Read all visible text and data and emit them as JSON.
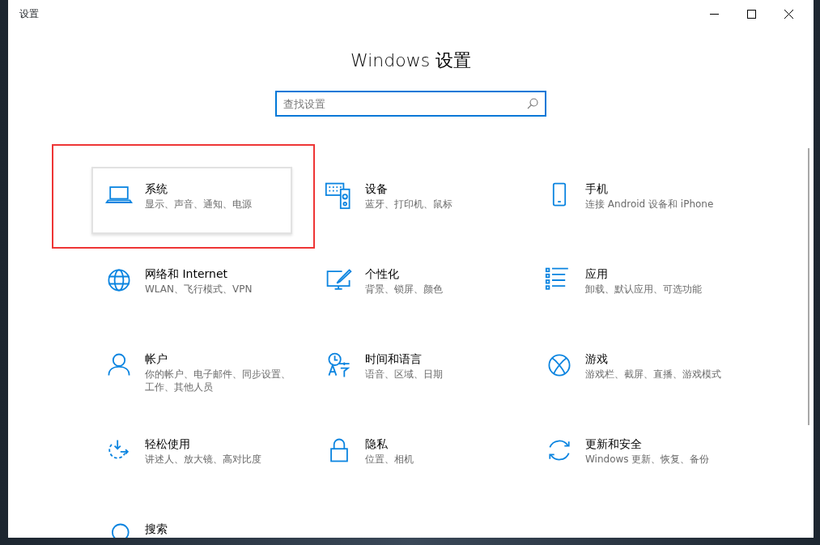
{
  "window": {
    "title": "设置"
  },
  "heading": "Windows 设置",
  "search": {
    "placeholder": "查找设置"
  },
  "items": [
    {
      "title": "系统",
      "description": "显示、声音、通知、电源",
      "selected": true,
      "annotated": true
    },
    {
      "title": "设备",
      "description": "蓝牙、打印机、鼠标",
      "selected": false,
      "annotated": false
    },
    {
      "title": "手机",
      "description": "连接 Android 设备和 iPhone",
      "selected": false,
      "annotated": false
    },
    {
      "title": "网络和 Internet",
      "description": "WLAN、飞行模式、VPN",
      "selected": false,
      "annotated": false
    },
    {
      "title": "个性化",
      "description": "背景、锁屏、颜色",
      "selected": false,
      "annotated": false
    },
    {
      "title": "应用",
      "description": "卸载、默认应用、可选功能",
      "selected": false,
      "annotated": false
    },
    {
      "title": "帐户",
      "description": "你的帐户、电子邮件、同步设置、工作、其他人员",
      "selected": false,
      "annotated": false
    },
    {
      "title": "时间和语言",
      "description": "语音、区域、日期",
      "selected": false,
      "annotated": false
    },
    {
      "title": "游戏",
      "description": "游戏栏、截屏、直播、游戏模式",
      "selected": false,
      "annotated": false
    },
    {
      "title": "轻松使用",
      "description": "讲述人、放大镜、高对比度",
      "selected": false,
      "annotated": false
    },
    {
      "title": "隐私",
      "description": "位置、相机",
      "selected": false,
      "annotated": false
    },
    {
      "title": "更新和安全",
      "description": "Windows 更新、恢复、备份",
      "selected": false,
      "annotated": false
    },
    {
      "title": "搜索",
      "selected": false,
      "annotated": false
    }
  ]
}
